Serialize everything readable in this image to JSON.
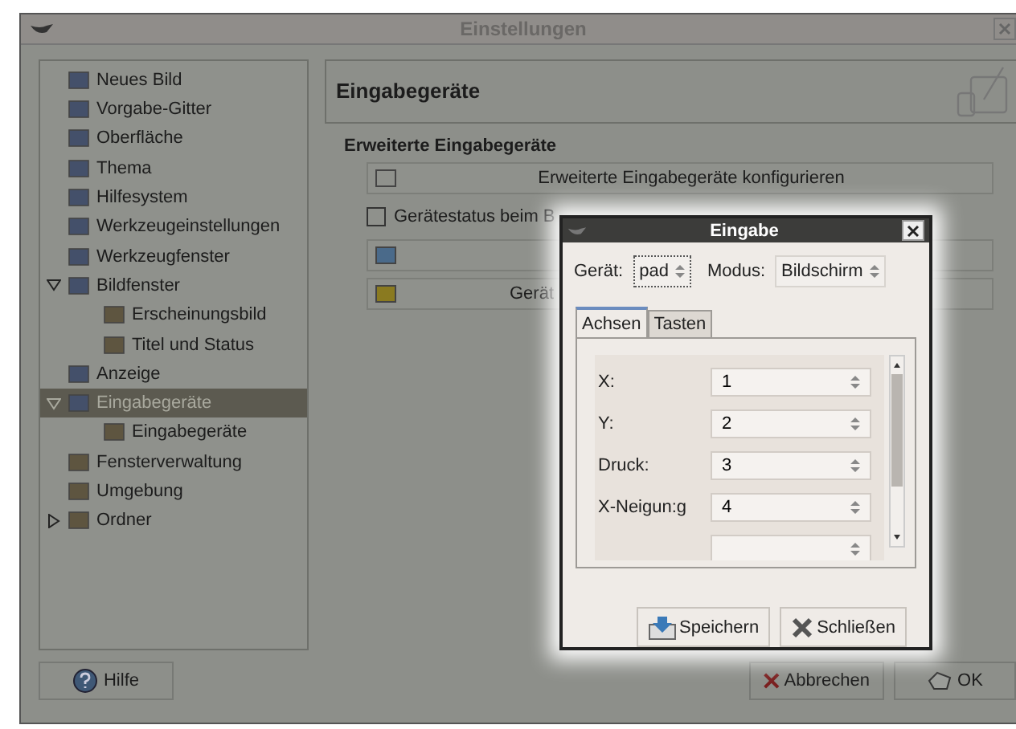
{
  "window": {
    "title": "Einstellungen"
  },
  "tree": [
    {
      "label": "Neues Bild",
      "selected": false
    },
    {
      "label": "Vorgabe-Gitter",
      "selected": false
    },
    {
      "label": "Oberfläche",
      "selected": false
    },
    {
      "label": "Thema",
      "selected": false
    },
    {
      "label": "Hilfesystem",
      "selected": false
    },
    {
      "label": "Werkzeugeinstellungen",
      "selected": false
    },
    {
      "label": "Werkzeugfenster",
      "selected": false
    },
    {
      "label": "Bildfenster",
      "selected": false,
      "expanded": true,
      "children": [
        {
          "label": "Erscheinungsbild",
          "selected": false
        },
        {
          "label": "Titel und Status",
          "selected": false
        }
      ]
    },
    {
      "label": "Anzeige",
      "selected": false
    },
    {
      "label": "Eingabegeräte",
      "selected": true,
      "expanded": true,
      "children": [
        {
          "label": "Eingabegeräte",
          "selected": false
        }
      ]
    },
    {
      "label": "Fensterverwaltung",
      "selected": false
    },
    {
      "label": "Umgebung",
      "selected": false
    },
    {
      "label": "Ordner",
      "selected": false,
      "expanded": false
    }
  ],
  "page": {
    "title": "Eingabegeräte",
    "section": "Erweiterte Eingabegeräte",
    "rows": [
      {
        "kind": "button",
        "label": "Erweiterte Eingabegeräte konfigurieren"
      },
      {
        "kind": "checkbox",
        "label": "Gerätestatus beim B",
        "checked": false
      },
      {
        "kind": "button",
        "label": ""
      },
      {
        "kind": "button",
        "label": "Gerät"
      }
    ]
  },
  "buttons_left": [
    "Hilfe"
  ],
  "buttons_right": [
    "Abbrechen",
    "OK"
  ],
  "dialog": {
    "title": "Eingabe",
    "device_label": "Gerät:",
    "device": "pad",
    "mode_label": "Modus:",
    "mode": "Bildschirm",
    "tabs": [
      {
        "label": "Achsen",
        "selected": true
      },
      {
        "label": "Tasten",
        "selected": false
      }
    ],
    "axes": [
      {
        "kind": "spin",
        "label": "X:",
        "value": "1"
      },
      {
        "kind": "spin",
        "label": "Y:",
        "value": "2"
      },
      {
        "kind": "spin",
        "label": "Druck:",
        "value": "3"
      },
      {
        "kind": "spin",
        "label": "X-Neigun:g",
        "value": "4"
      },
      {
        "kind": "spin"
      }
    ],
    "buttons": [
      "Speichern",
      "Schließen"
    ]
  }
}
